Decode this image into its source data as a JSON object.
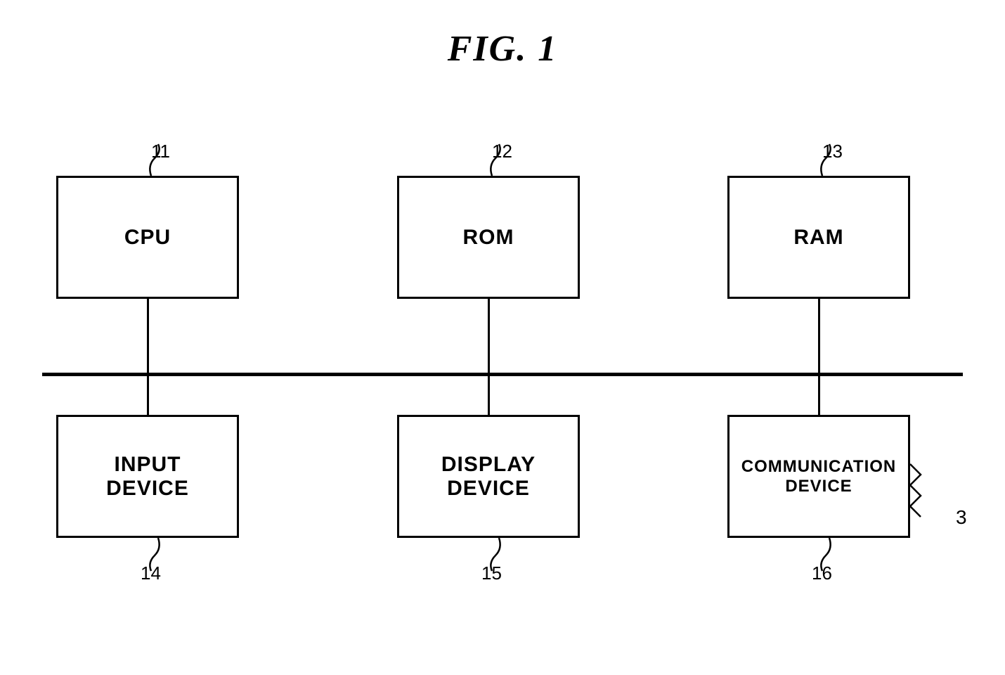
{
  "title": "FIG. 1",
  "boxes": {
    "cpu": {
      "label": "CPU",
      "ref": "11"
    },
    "rom": {
      "label": "ROM",
      "ref": "12"
    },
    "ram": {
      "label": "RAM",
      "ref": "13"
    },
    "input": {
      "label": "INPUT\nDEVICE",
      "ref": "14"
    },
    "display": {
      "label": "DISPLAY\nDEVICE",
      "ref": "15"
    },
    "comm": {
      "label": "COMMUNICATION\nDEVICE",
      "ref": "16"
    }
  },
  "external_ref": "3"
}
